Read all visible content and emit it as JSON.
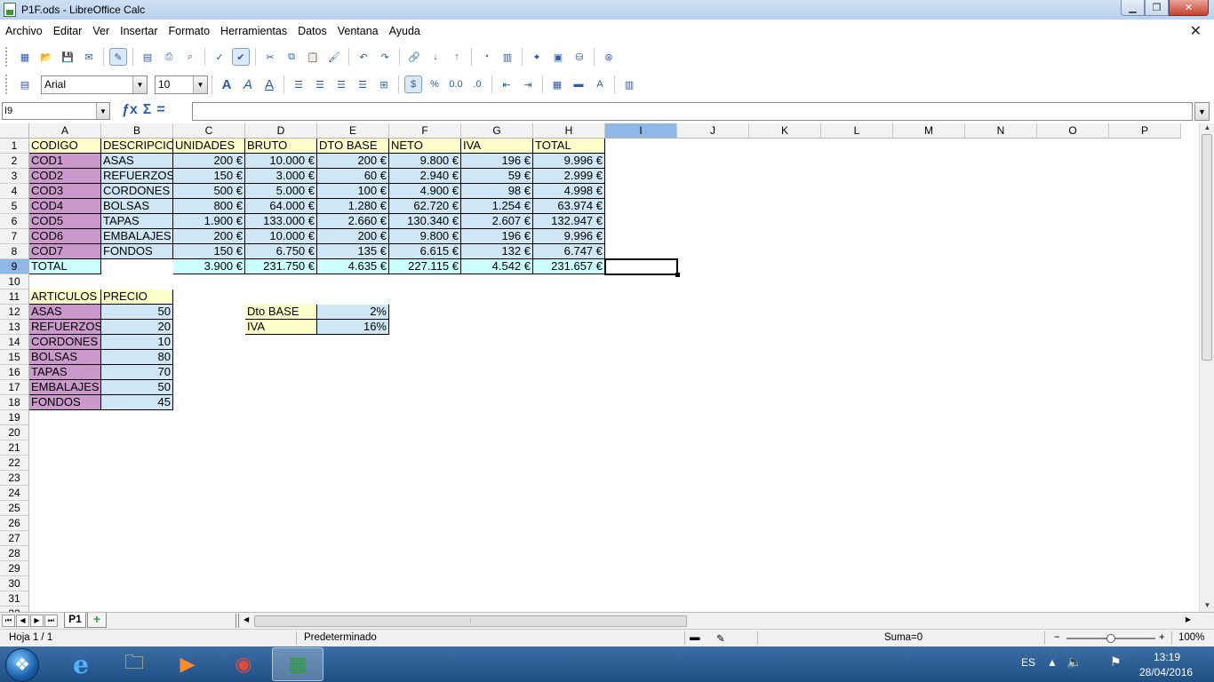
{
  "window": {
    "title": "P1F.ods - LibreOffice Calc",
    "min": "▁",
    "max": "❐",
    "close": "✕"
  },
  "menu": [
    "Archivo",
    "Editar",
    "Ver",
    "Insertar",
    "Formato",
    "Herramientas",
    "Datos",
    "Ventana",
    "Ayuda"
  ],
  "doc_close": "✕",
  "format_bar": {
    "font_name": "Arial",
    "font_size": "10"
  },
  "formula_bar": {
    "name_box": "I9",
    "content": ""
  },
  "columns": [
    "A",
    "B",
    "C",
    "D",
    "E",
    "F",
    "G",
    "H",
    "I",
    "J",
    "K",
    "L",
    "M",
    "N",
    "O",
    "P"
  ],
  "rows": [
    "1",
    "2",
    "3",
    "4",
    "5",
    "6",
    "7",
    "8",
    "9",
    "10",
    "11",
    "12",
    "13",
    "14",
    "15",
    "16",
    "17",
    "18",
    "19",
    "20",
    "21",
    "22",
    "23",
    "24",
    "25",
    "26",
    "27",
    "28",
    "29",
    "30",
    "31",
    "32"
  ],
  "sheet": {
    "headers": [
      "CODIGO",
      "DESCRIPCIO",
      "UNIDADES",
      "BRUTO",
      "DTO BASE",
      "NETO",
      "IVA",
      "TOTAL"
    ],
    "rows": [
      [
        "COD1",
        "ASAS",
        "200 €",
        "10.000 €",
        "200 €",
        "9.800 €",
        "196 €",
        "9.996 €"
      ],
      [
        "COD2",
        "REFUERZOS",
        "150 €",
        "3.000 €",
        "60 €",
        "2.940 €",
        "59 €",
        "2.999 €"
      ],
      [
        "COD3",
        "CORDONES",
        "500 €",
        "5.000 €",
        "100 €",
        "4.900 €",
        "98 €",
        "4.998 €"
      ],
      [
        "COD4",
        "BOLSAS",
        "800 €",
        "64.000 €",
        "1.280 €",
        "62.720 €",
        "1.254 €",
        "63.974 €"
      ],
      [
        "COD5",
        "TAPAS",
        "1.900 €",
        "133.000 €",
        "2.660 €",
        "130.340 €",
        "2.607 €",
        "132.947 €"
      ],
      [
        "COD6",
        "EMBALAJES",
        "200 €",
        "10.000 €",
        "200 €",
        "9.800 €",
        "196 €",
        "9.996 €"
      ],
      [
        "COD7",
        "FONDOS",
        "150 €",
        "6.750 €",
        "135 €",
        "6.615 €",
        "132 €",
        "6.747 €"
      ]
    ],
    "total_row": [
      "TOTAL",
      "",
      "3.900 €",
      "231.750 €",
      "4.635 €",
      "227.115 €",
      "4.542 €",
      "231.657 €"
    ],
    "articulos_header": [
      "ARTICULOS",
      "PRECIO"
    ],
    "articulos": [
      [
        "ASAS",
        "50"
      ],
      [
        "REFUERZOS",
        "20"
      ],
      [
        "CORDONES",
        "10"
      ],
      [
        "BOLSAS",
        "80"
      ],
      [
        "TAPAS",
        "70"
      ],
      [
        "EMBALAJES",
        "50"
      ],
      [
        "FONDOS",
        "45"
      ]
    ],
    "params": [
      [
        "Dto BASE",
        "2%"
      ],
      [
        "IVA",
        "16%"
      ]
    ]
  },
  "tabs": {
    "sheet_name": "P1",
    "add": "+"
  },
  "status": {
    "sheet_info": "Hoja 1 / 1",
    "style": "Predeterminado",
    "sum": "Suma=0",
    "zoom": "100%",
    "zoom_minus": "−",
    "zoom_plus": "+"
  },
  "taskbar": {
    "lang": "ES",
    "time": "13:19",
    "date": "28/04/2016"
  }
}
